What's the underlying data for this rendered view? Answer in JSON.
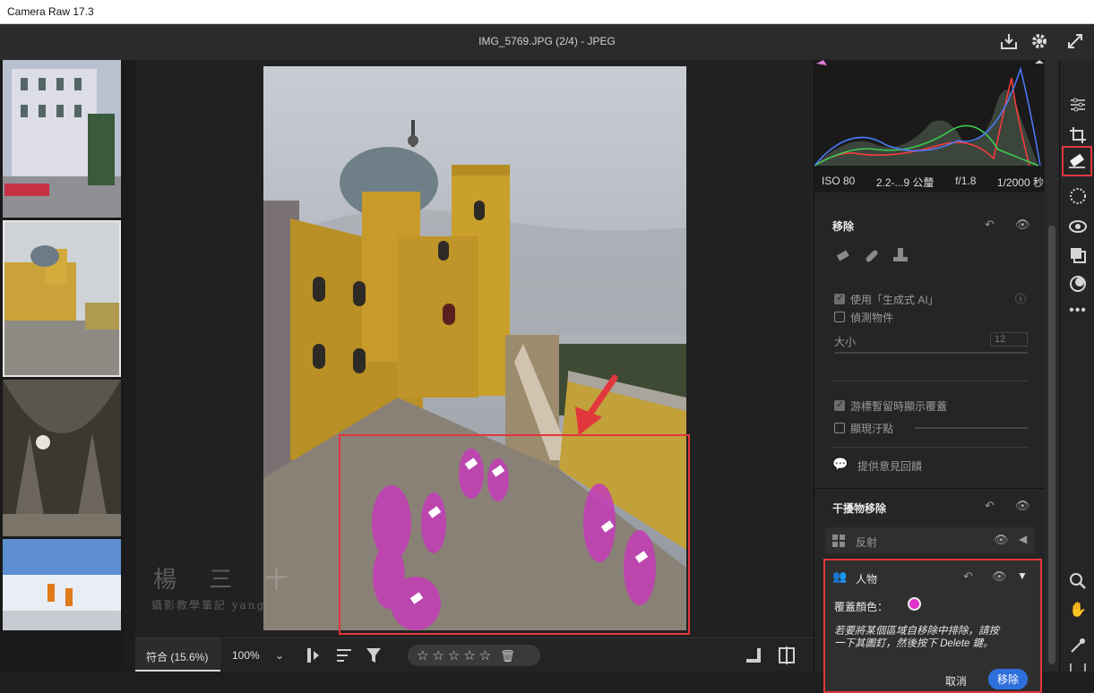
{
  "window": {
    "title": "Camera Raw 17.3"
  },
  "header": {
    "document_title": "IMG_5769.JPG (2/4)  -  JPEG",
    "icons": [
      "save-icon",
      "gear-icon",
      "fullscreen-icon"
    ]
  },
  "watermark": {
    "line1": "楊 三 十",
    "line2": "攝影教學筆記 yang"
  },
  "bottom": {
    "zoom_fit": "符合 (15.6%)",
    "zoom_percent": "100%",
    "stars": "☆☆☆☆☆"
  },
  "histogram": {
    "iso": "ISO 80",
    "lens": "2.2-...9 公釐",
    "aperture": "f/1.8",
    "shutter": "1/2000 秒"
  },
  "remove": {
    "title": "移除",
    "use_gen_ai": "使用「生成式 AI」",
    "detect_objects": "偵測物件",
    "size_label": "大小",
    "size_value": "12",
    "hover_overlay": "游標暫留時顯示覆蓋",
    "show_spots": "顯現汙點",
    "feedback": "提供意見回饋"
  },
  "distraction": {
    "title": "干擾物移除",
    "reflection": "反射",
    "people": "人物",
    "overlay_color_label": "覆蓋顏色：",
    "overlay_color": "#e030c8",
    "instruction": "若要將某個區域自移除中排除，請按一下其圖釘，然後按下 Delete 鍵。",
    "cancel": "取消",
    "remove_btn": "移除"
  },
  "colors": {
    "accent": "#2d6fdc",
    "highlight": "#e1363c",
    "mask": "#c43cb8"
  }
}
